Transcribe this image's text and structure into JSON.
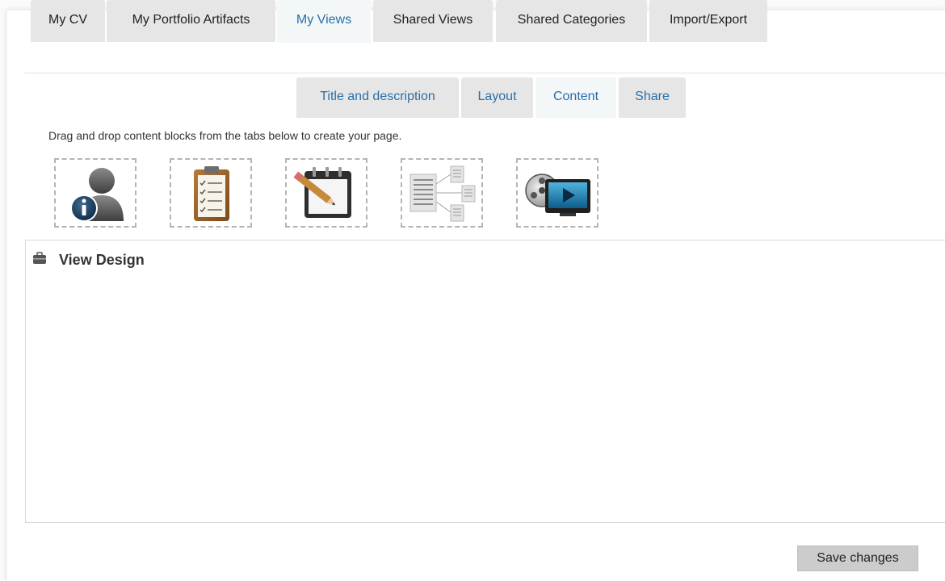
{
  "main_tabs": [
    {
      "label": "My CV",
      "active": false
    },
    {
      "label": "My Portfolio Artifacts",
      "active": false
    },
    {
      "label": "My Views",
      "active": true
    },
    {
      "label": "Shared Views",
      "active": false
    },
    {
      "label": "Shared Categories",
      "active": false
    },
    {
      "label": "Import/Export",
      "active": false
    }
  ],
  "sub_tabs": [
    {
      "label": "Title and description",
      "active": false
    },
    {
      "label": "Layout",
      "active": false
    },
    {
      "label": "Content",
      "active": true
    },
    {
      "label": "Share",
      "active": false
    }
  ],
  "instructions": "Drag and drop content blocks from the tabs below to create your page.",
  "content_blocks": [
    {
      "icon": "user-info-icon"
    },
    {
      "icon": "clipboard-checklist-icon"
    },
    {
      "icon": "notepad-pencil-icon"
    },
    {
      "icon": "document-tree-icon"
    },
    {
      "icon": "video-media-icon"
    }
  ],
  "design": {
    "title": "View Design",
    "icon": "briefcase-icon"
  },
  "save_label": "Save changes",
  "colors": {
    "active_tab_text": "#2a6fa8",
    "tab_background": "#e6e6e6",
    "active_tab_background": "#f3f7f8",
    "button_background": "#cccccc"
  }
}
